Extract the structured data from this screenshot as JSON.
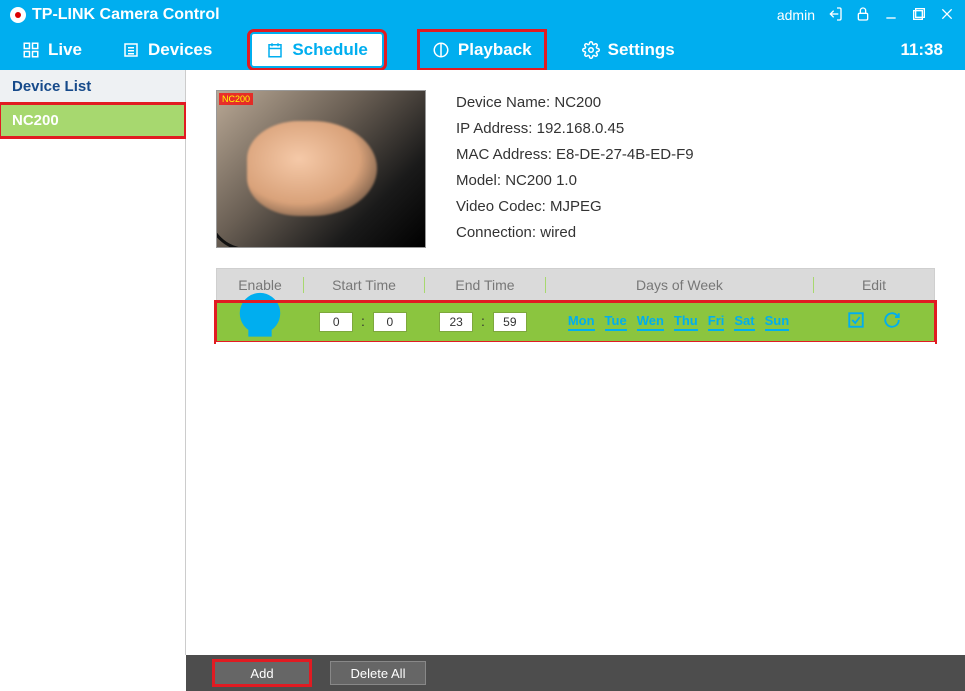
{
  "titlebar": {
    "appTitle": "TP-LINK Camera Control",
    "user": "admin"
  },
  "nav": {
    "live": "Live",
    "devices": "Devices",
    "schedule": "Schedule",
    "playback": "Playback",
    "settings": "Settings",
    "clock": "11:38"
  },
  "sidebar": {
    "header": "Device List",
    "items": [
      "NC200"
    ]
  },
  "device": {
    "nameLabel": "Device Name: ",
    "name": "NC200",
    "ipLabel": "IP Address: ",
    "ip": "192.168.0.45",
    "macLabel": "MAC Address: ",
    "mac": "E8-DE-27-4B-ED-F9",
    "modelLabel": "Model: ",
    "model": "NC200 1.0",
    "codecLabel": "Video Codec: ",
    "codec": "MJPEG",
    "connLabel": "Connection: ",
    "conn": "wired"
  },
  "table": {
    "headers": {
      "enable": "Enable",
      "start": "Start Time",
      "end": "End Time",
      "days": "Days of Week",
      "edit": "Edit"
    },
    "row": {
      "startH": "0",
      "startM": "0",
      "endH": "23",
      "endM": "59",
      "days": [
        "Mon",
        "Tue",
        "Wen",
        "Thu",
        "Fri",
        "Sat",
        "Sun"
      ]
    }
  },
  "buttons": {
    "add": "Add",
    "deleteAll": "Delete All"
  }
}
